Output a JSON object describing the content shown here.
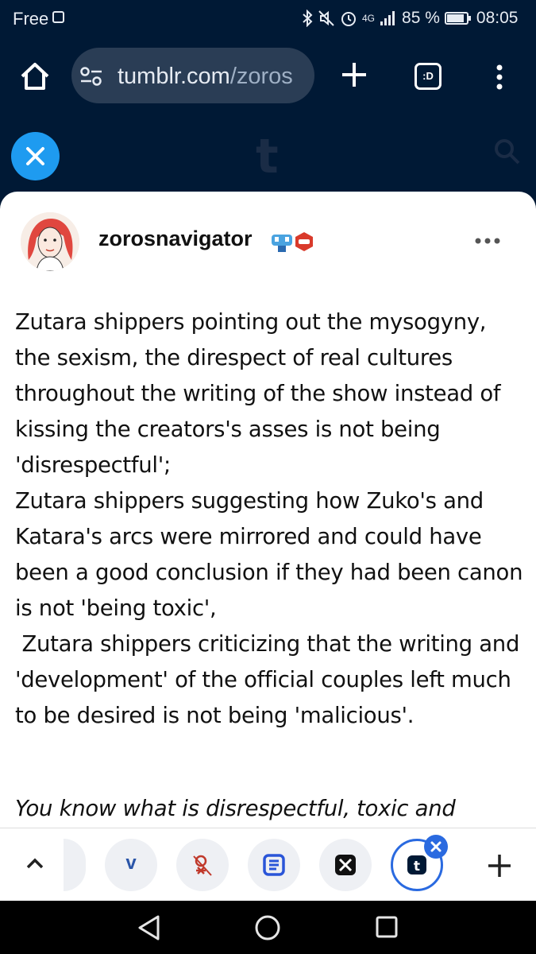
{
  "status_bar": {
    "carrier": "Free",
    "network": "4G",
    "battery": "85 %",
    "time": "08:05"
  },
  "browser": {
    "url_host": "tumblr.com",
    "url_path": "/zoros",
    "tab_switcher_label": ":D"
  },
  "tumblr": {
    "logo": "t"
  },
  "post": {
    "username": "zorosnavigator",
    "paragraph1": "Zutara shippers pointing out the mysogyny, the sexism, the direspect of real cultures throughout the writing of the show instead of kissing the creators's asses is not being 'disrespectful';",
    "paragraph2": "Zutara shippers suggesting how Zuko's and Katara's arcs were mirrored and could have been a good conclusion if they had been canon is not 'being toxic',",
    "paragraph3": " Zutara shippers criticizing that the writing and 'development' of the official couples left much to be desired is not being 'malicious'.",
    "paragraph4": "You know what is disrespectful, toxic and"
  },
  "toolbar": {
    "tab_v_label": "v"
  },
  "colors": {
    "header_bg": "#001935",
    "accent": "#1e9bf0",
    "active_tab": "#2a6ae0"
  }
}
